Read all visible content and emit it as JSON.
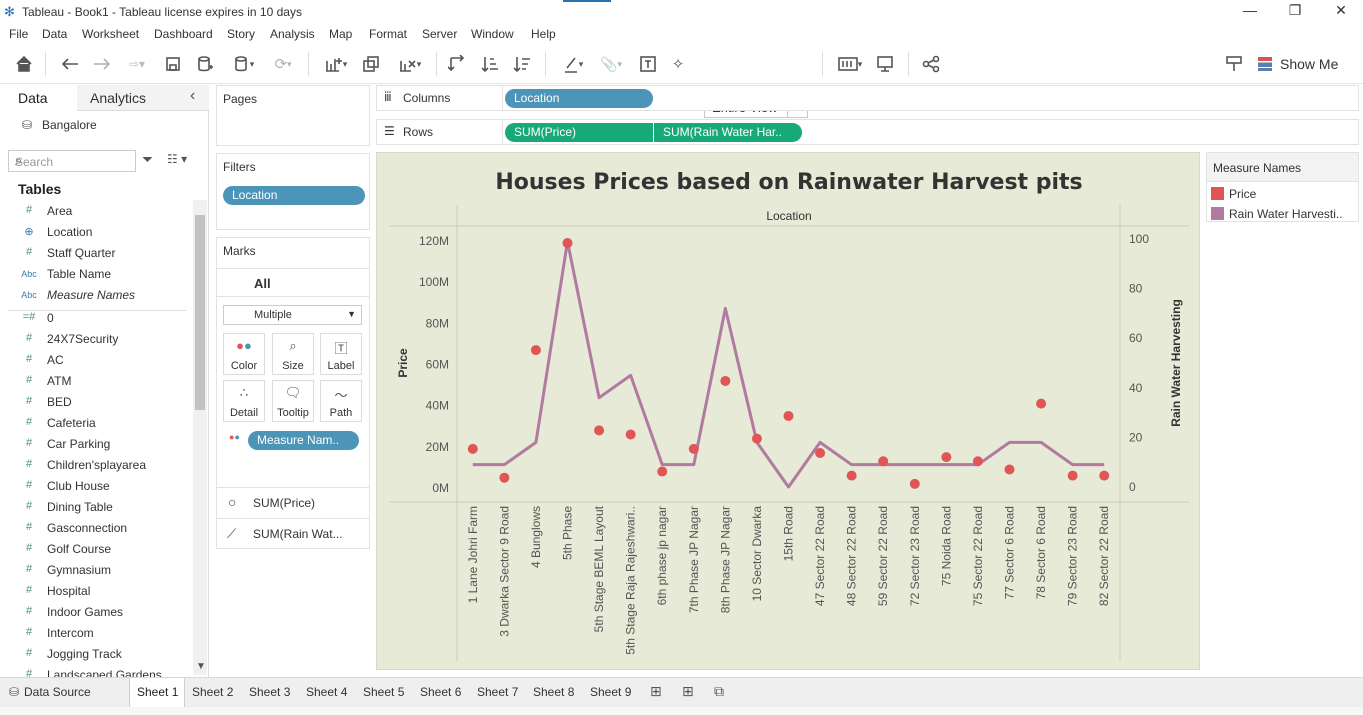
{
  "window": {
    "title": "Tableau - Book1 - Tableau license expires in 10 days"
  },
  "menu": [
    "File",
    "Data",
    "Worksheet",
    "Dashboard",
    "Story",
    "Analysis",
    "Map",
    "Format",
    "Server",
    "Window",
    "Help"
  ],
  "toolbar": {
    "fit": "Entire View",
    "show_me": "Show Me"
  },
  "data_pane": {
    "tab_data": "Data",
    "tab_analytics": "Analytics",
    "collapse": "‹",
    "datasource": "Bangalore",
    "search_placeholder": "Search",
    "tables_label": "Tables",
    "fields": [
      {
        "icon": "#",
        "name": "Area"
      },
      {
        "icon": "⊕",
        "name": "Location"
      },
      {
        "icon": "#",
        "name": "Staff Quarter"
      },
      {
        "icon": "Abc",
        "name": "Table Name"
      },
      {
        "icon": "Abc",
        "name": "Measure Names"
      },
      {
        "icon": "=#",
        "name": "0"
      },
      {
        "icon": "#",
        "name": "24X7Security"
      },
      {
        "icon": "#",
        "name": "AC"
      },
      {
        "icon": "#",
        "name": "ATM"
      },
      {
        "icon": "#",
        "name": "BED"
      },
      {
        "icon": "#",
        "name": "Cafeteria"
      },
      {
        "icon": "#",
        "name": "Car Parking"
      },
      {
        "icon": "#",
        "name": "Children'splayarea"
      },
      {
        "icon": "#",
        "name": "Club House"
      },
      {
        "icon": "#",
        "name": "Dining Table"
      },
      {
        "icon": "#",
        "name": "Gasconnection"
      },
      {
        "icon": "#",
        "name": "Golf Course"
      },
      {
        "icon": "#",
        "name": "Gymnasium"
      },
      {
        "icon": "#",
        "name": "Hospital"
      },
      {
        "icon": "#",
        "name": "Indoor Games"
      },
      {
        "icon": "#",
        "name": "Intercom"
      },
      {
        "icon": "#",
        "name": "Jogging Track"
      },
      {
        "icon": "#",
        "name": "Landscaped Gardens"
      }
    ]
  },
  "pages_card": {
    "title": "Pages"
  },
  "filters_card": {
    "title": "Filters",
    "pill": "Location"
  },
  "marks_card": {
    "title": "Marks",
    "all": "All",
    "mark_type": "Multiple",
    "buttons": [
      "Color",
      "Size",
      "Label",
      "Detail",
      "Tooltip",
      "Path"
    ],
    "color_pill": "Measure Nam..",
    "measures": [
      "SUM(Price)",
      "SUM(Rain Wat..."
    ]
  },
  "shelves": {
    "columns_label": "Columns",
    "columns_pill": "Location",
    "rows_label": "Rows",
    "rows_pills": [
      "SUM(Price)",
      "SUM(Rain Water Har.."
    ]
  },
  "legend": {
    "title": "Measure Names",
    "items": [
      {
        "label": "Price",
        "color": "#e05555"
      },
      {
        "label": "Rain Water Harvesti..",
        "color": "#b07aa1"
      }
    ]
  },
  "sheet_tabs": {
    "datasource": "Data Source",
    "sheets": [
      "Sheet 1",
      "Sheet 2",
      "Sheet 3",
      "Sheet 4",
      "Sheet 5",
      "Sheet 6",
      "Sheet 7",
      "Sheet 8",
      "Sheet 9"
    ],
    "active": "Sheet 1"
  },
  "chart_data": {
    "type": "line",
    "title": "Houses Prices based on Rainwater Harvest pits",
    "header": "Location",
    "xlabel": "Location",
    "ylabel_left": "Price",
    "ylabel_right": "Rain Water Harvesting",
    "left_ticks": [
      "0M",
      "20M",
      "40M",
      "60M",
      "80M",
      "100M",
      "120M"
    ],
    "right_ticks": [
      "0",
      "20",
      "40",
      "60",
      "80",
      "100"
    ],
    "ylim_left": [
      0,
      120000000
    ],
    "ylim_right": [
      0,
      100
    ],
    "categories": [
      "1 Lane Johri Farm",
      "3 Dwarka Sector 9 Road",
      "4 Bunglows",
      "5th Phase",
      "5th Stage BEML Layout",
      "5th Stage Raja Rajeshwari..",
      "6th phase jp nagar",
      "7th Phase JP Nagar",
      "8th Phase JP Nagar",
      "10 Sector Dwarka",
      "15th Road",
      "47 Sector 22 Road",
      "48 Sector 22 Road",
      "59 Sector 22 Road",
      "72 Sector 23 Road",
      "75 Noida Road",
      "75 Sector 22 Road",
      "77 Sector 6 Road",
      "78 Sector 6 Road",
      "79 Sector 23 Road",
      "82 Sector 22 Road"
    ],
    "series": [
      {
        "name": "Price",
        "mark": "circle",
        "color": "#e05555",
        "values": [
          19000000,
          5000000,
          67000000,
          119000000,
          28000000,
          26000000,
          8000000,
          19000000,
          52000000,
          24000000,
          35000000,
          17000000,
          6000000,
          13000000,
          2000000,
          15000000,
          13000000,
          9000000,
          41000000,
          6000000,
          6000000
        ]
      },
      {
        "name": "Rain Water Harvesting",
        "mark": "line",
        "color": "#b07aa1",
        "values": [
          9,
          9,
          18,
          99,
          36,
          45,
          9,
          9,
          72,
          18,
          0,
          18,
          9,
          9,
          9,
          9,
          9,
          18,
          18,
          9,
          9
        ]
      }
    ]
  }
}
